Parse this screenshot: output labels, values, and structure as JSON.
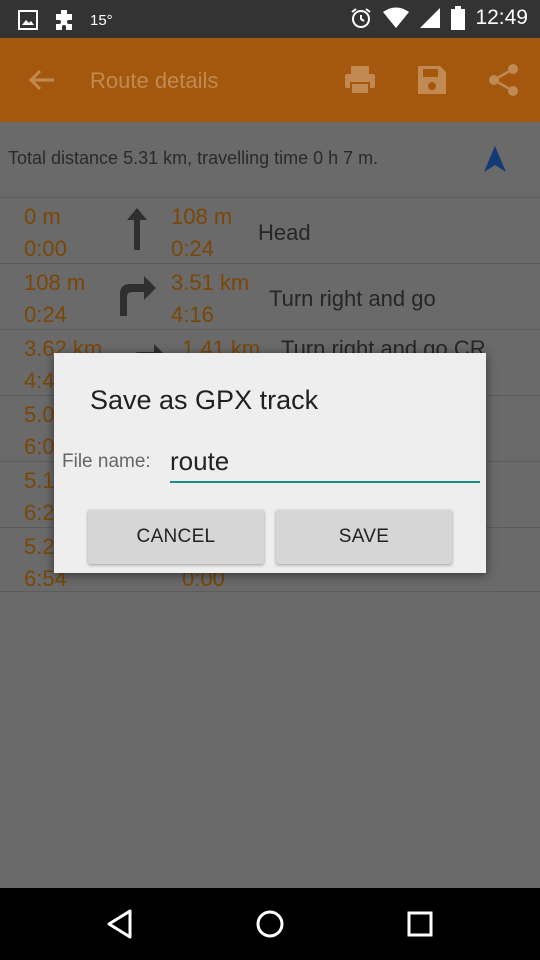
{
  "status_bar": {
    "temperature": "15°",
    "time": "12:49",
    "icons": [
      "image-icon",
      "puzzle-icon",
      "alarm-icon",
      "wifi-icon",
      "signal-icon",
      "battery-icon"
    ]
  },
  "app_bar": {
    "title": "Route details",
    "icons": [
      "back-arrow-icon",
      "print-icon",
      "save-icon",
      "share-icon"
    ],
    "color": "#a3580e"
  },
  "summary": {
    "text": "Total distance 5.31 km, travelling time 0 h 7 m."
  },
  "route_rows": [
    {
      "dist": "0 m",
      "time": "0:00",
      "seg_dist": "108 m",
      "seg_time": "0:24",
      "desc": "Head",
      "turn": "straight-arrow-icon"
    },
    {
      "dist": "108 m",
      "time": "0:24",
      "seg_dist": "3.51 km",
      "seg_time": "4:16",
      "desc": "Turn right and go",
      "turn": "turn-right-icon"
    },
    {
      "dist": "3.62 km",
      "time": "4:4",
      "seg_dist": "1.41 km",
      "seg_time": "",
      "desc": "Turn right and go CR",
      "turn": "slight-right-icon"
    },
    {
      "dist": "5.0",
      "time": "6:0",
      "seg_dist": "",
      "seg_time": "",
      "desc": "",
      "turn": ""
    },
    {
      "dist": "5.1",
      "time": "6:2",
      "seg_dist": "",
      "seg_time": "",
      "desc": "",
      "turn": ""
    },
    {
      "dist": "5.2",
      "time": "6:54",
      "seg_dist": "",
      "seg_time": "0:00",
      "desc": "",
      "turn": ""
    }
  ],
  "dialog": {
    "title": "Save as GPX track",
    "field_label": "File name:",
    "field_value": "route",
    "cancel_label": "CANCEL",
    "save_label": "SAVE"
  },
  "nav_bar": {
    "icons": [
      "back-triangle-icon",
      "home-circle-icon",
      "recents-square-icon"
    ]
  }
}
